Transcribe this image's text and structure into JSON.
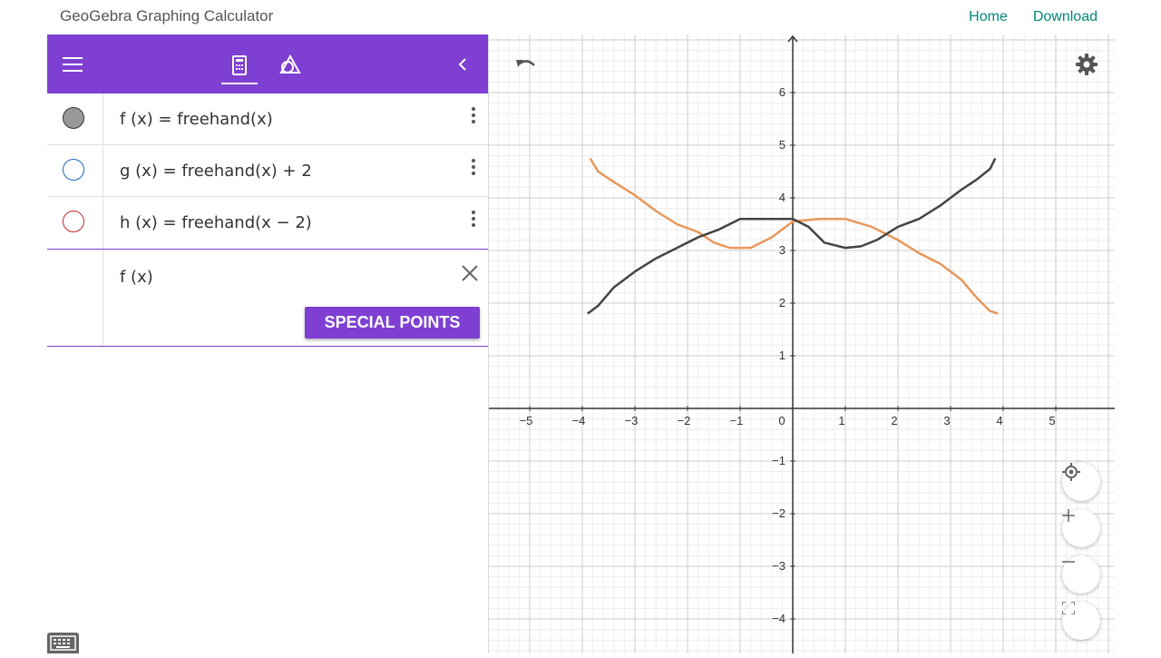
{
  "app": {
    "title": "GeoGebra Graphing Calculator"
  },
  "nav": {
    "home": "Home",
    "download": "Download"
  },
  "colors": {
    "accent": "#7e3fd2",
    "link": "#00897b",
    "f": "#444444",
    "orange": "#e8975a"
  },
  "toolbar": {
    "menu_icon": "menu-icon",
    "calc_icon": "calculator-icon",
    "geo_icon": "geometry-icon",
    "collapse_icon": "chevron-left-icon"
  },
  "algebra": {
    "rows": [
      {
        "expr": "f (x)  =  freehand(x)",
        "marble": "filled-gray"
      },
      {
        "expr": "g (x)  =  freehand(x) + 2",
        "marble": "blue-outline"
      },
      {
        "expr": "h (x)  =  freehand(x − 2)",
        "marble": "red-outline"
      }
    ],
    "input": {
      "expr": "f (x)",
      "button": "SPECIAL POINTS"
    }
  },
  "graph": {
    "x_ticks": [
      "−5",
      "−4",
      "−3",
      "−2",
      "−1",
      "0",
      "1",
      "2",
      "3",
      "4",
      "5"
    ],
    "y_ticks": [
      "6",
      "5",
      "4",
      "3",
      "2",
      "1",
      "−1",
      "−2",
      "−3",
      "−4"
    ],
    "fab_icons": [
      "locate-icon",
      "zoom-in-icon",
      "zoom-out-icon",
      "fullscreen-icon"
    ]
  }
}
